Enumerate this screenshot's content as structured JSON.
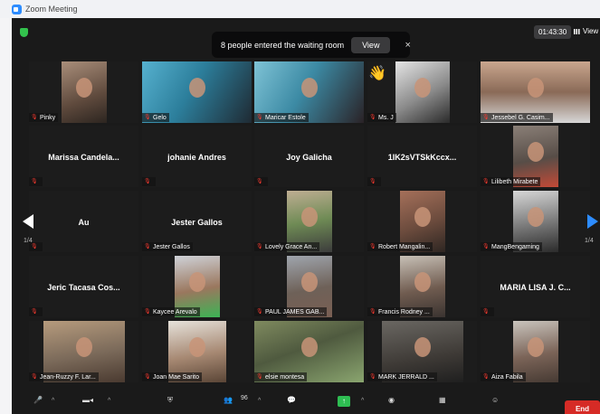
{
  "titlebar": {
    "title": "Zoom Meeting"
  },
  "notification": {
    "text": "8 people entered the waiting room",
    "view_label": "View",
    "close": "×"
  },
  "timer": "01:43:30",
  "view_label": "View",
  "pagination": {
    "left": "1/4",
    "right": "1/4"
  },
  "participants": [
    {
      "name": "Pinky",
      "video": true
    },
    {
      "name": "Gelo",
      "video": true
    },
    {
      "name": "Maricar Estole",
      "video": true,
      "active": true
    },
    {
      "name": "Ms. J",
      "video": true,
      "reaction": "👋"
    },
    {
      "name": "Jessebel G. Casim...",
      "video": true
    },
    {
      "name": "Marissa  Candela...",
      "video": false
    },
    {
      "name": "johanie Andres",
      "video": false
    },
    {
      "name": "Joy Galicha",
      "video": false
    },
    {
      "name": "1IK2sVTSkKccx...",
      "video": false
    },
    {
      "name": "Lilibeth Mirabete",
      "video": true
    },
    {
      "name": "Au",
      "video": false
    },
    {
      "name": "Jester Gallos",
      "video": false
    },
    {
      "name": "Lovely Grace An...",
      "video": true
    },
    {
      "name": "Robert Mangalin...",
      "video": true
    },
    {
      "name": "MangBengaming",
      "video": true
    },
    {
      "name": "Jeric Tacasa Cos...",
      "video": false
    },
    {
      "name": "Kaycee Arevalo",
      "video": true
    },
    {
      "name": "PAUL JAMES GAB...",
      "video": true
    },
    {
      "name": "Francis Rodney ...",
      "video": true
    },
    {
      "name": "MARIA LISA J. C...",
      "video": false
    },
    {
      "name": "Jean-Ruzzy F. Lar...",
      "video": true
    },
    {
      "name": "Joan Mae Sarito",
      "video": true
    },
    {
      "name": "elsie montesa",
      "video": true
    },
    {
      "name": "MARK JERRALD ...",
      "video": true
    },
    {
      "name": "Aiza Fabila",
      "video": true
    }
  ],
  "toolbar": {
    "participants_count": "96",
    "end_label": "End"
  }
}
